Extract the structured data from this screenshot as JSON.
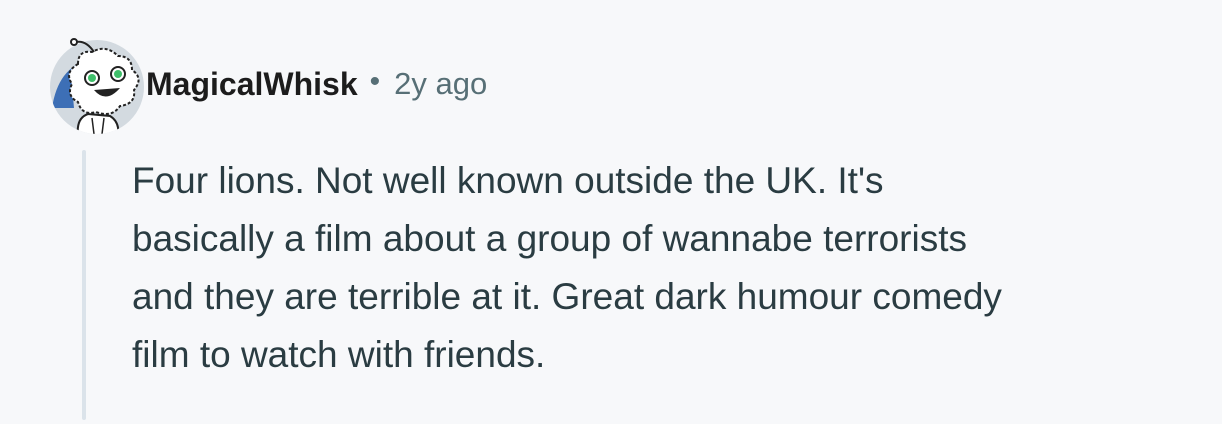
{
  "comment": {
    "author": "MagicalWhisk",
    "separator": "•",
    "age": "2y ago",
    "avatar_icon": "snoo-avatar-icon",
    "body_lines": [
      "Four lions. Not well known outside the UK. It's",
      "basically a film about a group of wannabe terrorists",
      "and they are terrible at it. Great dark humour comedy",
      "film to watch with friends."
    ]
  },
  "colors": {
    "background": "#f7f8fa",
    "username": "#1c1c1c",
    "meta_text": "#576f76",
    "body_text": "#2a3c42",
    "thread_line": "#dbe3ea",
    "avatar_blue": "#3d6fb6",
    "avatar_eye_green": "#3fbf6a"
  }
}
